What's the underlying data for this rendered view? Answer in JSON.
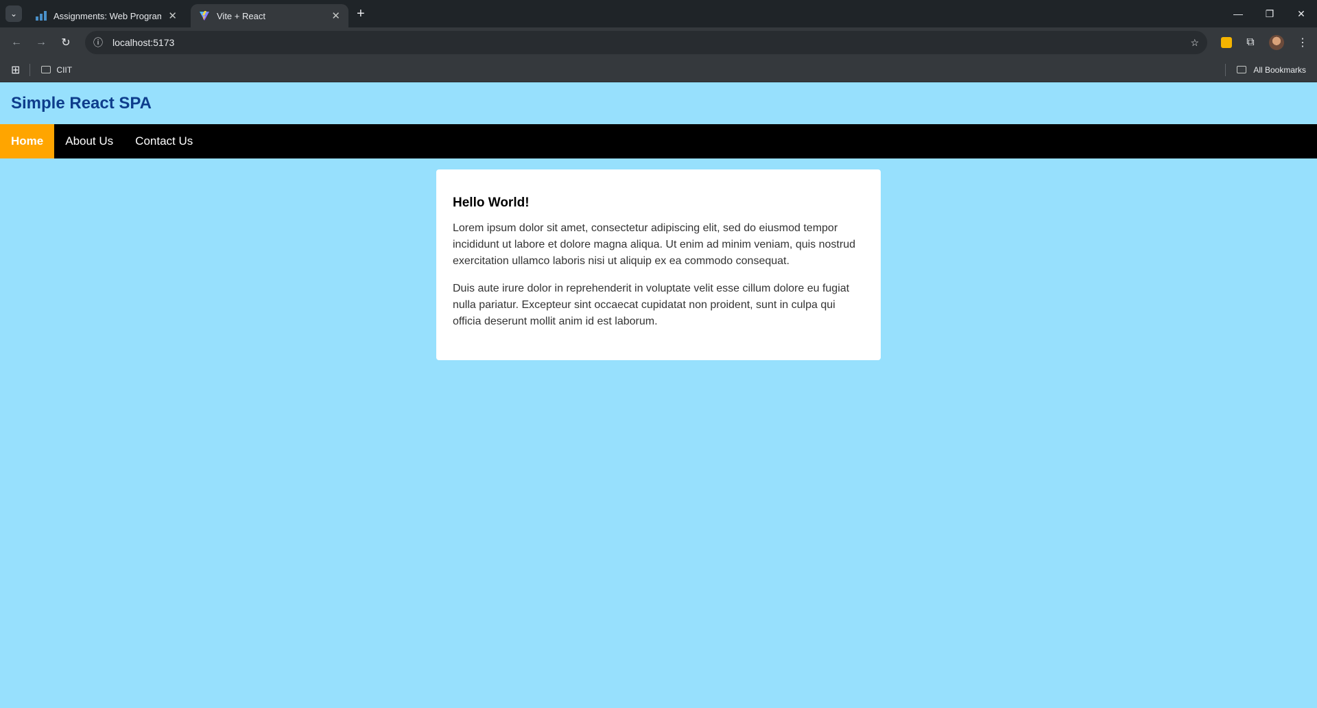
{
  "browser": {
    "tabs": [
      {
        "title": "Assignments: Web Programmin",
        "active": false,
        "favicon": "chart-bars-icon"
      },
      {
        "title": "Vite + React",
        "active": true,
        "favicon": "vite-icon"
      }
    ],
    "address": "localhost:5173",
    "bookmarks": [
      {
        "label": "CIIT"
      }
    ],
    "all_bookmarks_label": "All Bookmarks"
  },
  "site": {
    "title": "Simple React SPA",
    "nav": [
      {
        "label": "Home",
        "active": true
      },
      {
        "label": "About Us",
        "active": false
      },
      {
        "label": "Contact Us",
        "active": false
      }
    ],
    "card": {
      "heading": "Hello World!",
      "paragraphs": [
        "Lorem ipsum dolor sit amet, consectetur adipiscing elit, sed do eiusmod tempor incididunt ut labore et dolore magna aliqua. Ut enim ad minim veniam, quis nostrud exercitation ullamco laboris nisi ut aliquip ex ea commodo consequat.",
        "Duis aute irure dolor in reprehenderit in voluptate velit esse cillum dolore eu fugiat nulla pariatur. Excepteur sint occaecat cupidatat non proident, sunt in culpa qui officia deserunt mollit anim id est laborum."
      ]
    }
  },
  "colors": {
    "page_background": "#97e0fd",
    "title_color": "#0e3d8c",
    "nav_background": "#000000",
    "nav_active": "#ffa500"
  }
}
